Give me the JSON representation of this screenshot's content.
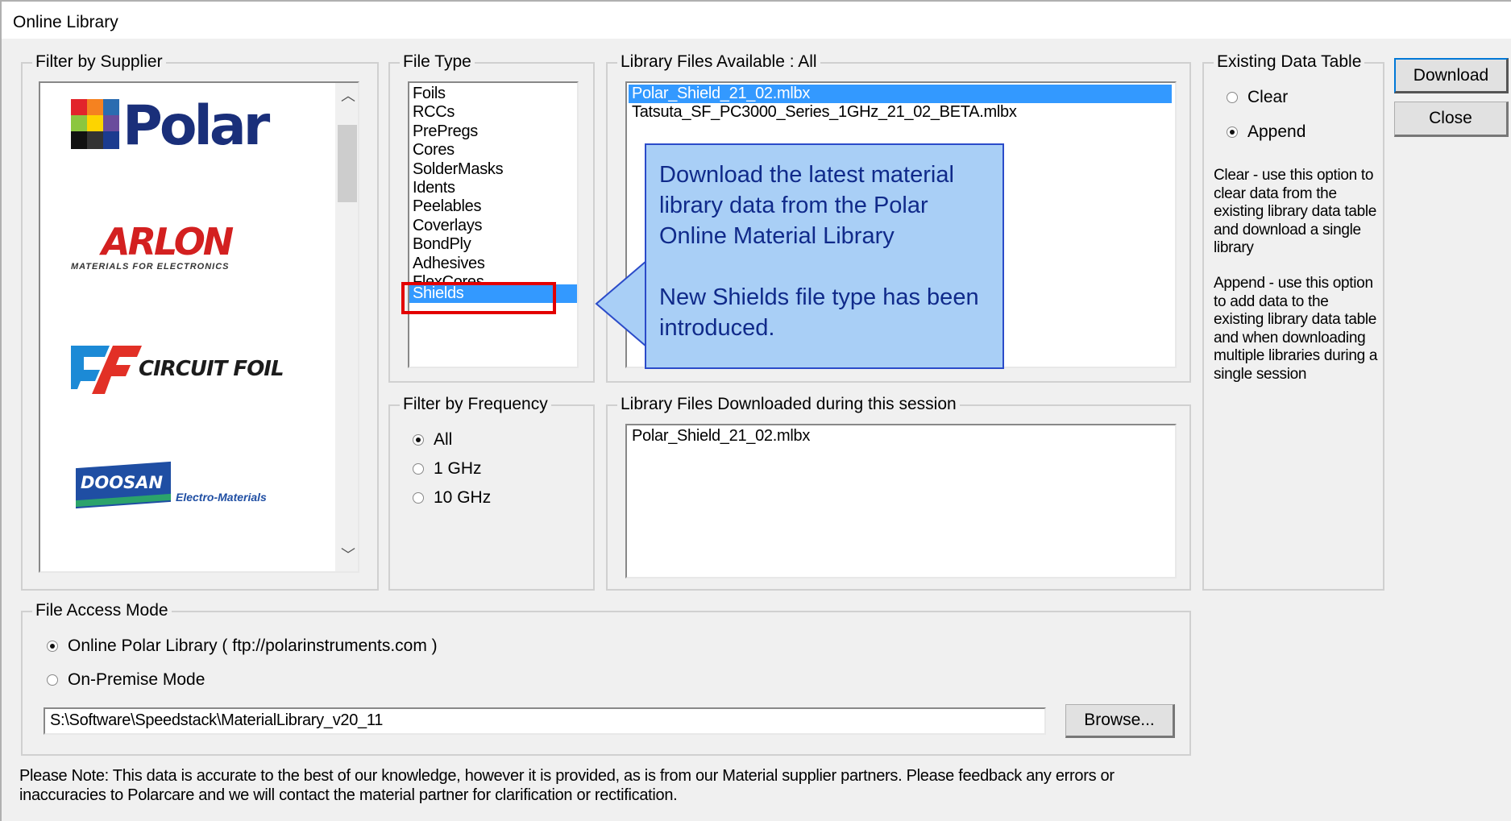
{
  "window": {
    "title": "Online Library"
  },
  "supplier_group": {
    "label": "Filter by Supplier",
    "logos": [
      {
        "name": "Polar",
        "tagline": ""
      },
      {
        "name": "ARLON",
        "tagline": "MATERIALS FOR ELECTRONICS"
      },
      {
        "name": "CIRCUIT FOIL",
        "tagline": ""
      },
      {
        "name": "DOOSAN",
        "tagline": "Electro-Materials"
      }
    ]
  },
  "file_type": {
    "label": "File Type",
    "items": [
      "Foils",
      "RCCs",
      "PrePregs",
      "Cores",
      "SolderMasks",
      "Idents",
      "Peelables",
      "Coverlays",
      "BondPly",
      "Adhesives",
      "FlexCores",
      "Shields"
    ],
    "selected": "Shields"
  },
  "library_files": {
    "label": "Library Files Available : All",
    "items": [
      "Polar_Shield_21_02.mlbx",
      "Tatsuta_SF_PC3000_Series_1GHz_21_02_BETA.mlbx"
    ],
    "selected": "Polar_Shield_21_02.mlbx"
  },
  "callout": {
    "line1": "Download the latest material library data from the Polar Online Material Library",
    "line2": "New Shields file type has been introduced.",
    "highlight_color": "#e30000"
  },
  "existing_table": {
    "label": "Existing Data Table",
    "options": [
      "Clear",
      "Append"
    ],
    "selected": "Append",
    "help_clear": "Clear - use this option to clear data from the existing library data table and download a single library",
    "help_append": "Append - use this option to add data to the existing library data table and when downloading multiple libraries during a single session"
  },
  "buttons": {
    "download": "Download",
    "close": "Close",
    "browse": "Browse..."
  },
  "frequency": {
    "label": "Filter by Frequency",
    "options": [
      "All",
      "1 GHz",
      "10 GHz"
    ],
    "selected": "All"
  },
  "downloaded": {
    "label": "Library Files Downloaded during this session",
    "items": [
      "Polar_Shield_21_02.mlbx"
    ]
  },
  "access_mode": {
    "label": "File Access Mode",
    "online": "Online Polar Library ( ftp://polarinstruments.com )",
    "onpremise": "On-Premise Mode",
    "selected": "online",
    "path": "S:\\Software\\Speedstack\\MaterialLibrary_v20_11"
  },
  "note": {
    "line1": "Please Note:  This data is accurate to the best of our knowledge, however it is provided, as is from our Material supplier partners.  Please feedback any errors or",
    "line2": "inaccuracies to Polarcare and we will contact the material partner for clarification or rectification."
  }
}
